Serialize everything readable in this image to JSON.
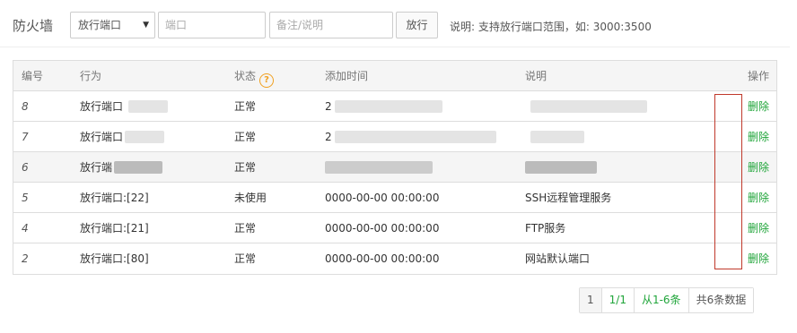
{
  "toolbar": {
    "title": "防火墙",
    "select_value": "放行端口",
    "port_placeholder": "端口",
    "note_placeholder": "备注/说明",
    "submit_label": "放行",
    "hint": "说明: 支持放行端口范围，如: 3000:3500"
  },
  "table": {
    "headers": {
      "id": "编号",
      "action": "行为",
      "status": "状态",
      "time": "添加时间",
      "note": "说明",
      "op": "操作"
    },
    "help_icon": "?",
    "rows": [
      {
        "id": "8",
        "action": "放行端口",
        "status": "正常",
        "time": "2",
        "note": "",
        "op": "删除"
      },
      {
        "id": "7",
        "action": "放行端口",
        "status": "正常",
        "time": "2",
        "note": "",
        "op": "删除"
      },
      {
        "id": "6",
        "action": "放行端",
        "status": "正常",
        "time": "",
        "note": "",
        "op": "删除"
      },
      {
        "id": "5",
        "action": "放行端口:[22]",
        "status": "未使用",
        "time": "0000-00-00 00:00:00",
        "note": "SSH远程管理服务",
        "op": "删除"
      },
      {
        "id": "4",
        "action": "放行端口:[21]",
        "status": "正常",
        "time": "0000-00-00 00:00:00",
        "note": "FTP服务",
        "op": "删除"
      },
      {
        "id": "2",
        "action": "放行端口:[80]",
        "status": "正常",
        "time": "0000-00-00 00:00:00",
        "note": "网站默认端口",
        "op": "删除"
      }
    ]
  },
  "pager": {
    "current": "1",
    "pages": "1/1",
    "range": "从1-6条",
    "total": "共6条数据"
  },
  "colors": {
    "accent": "#20a53a",
    "warning": "#f0a020",
    "highlight_box": "#c0392b"
  }
}
